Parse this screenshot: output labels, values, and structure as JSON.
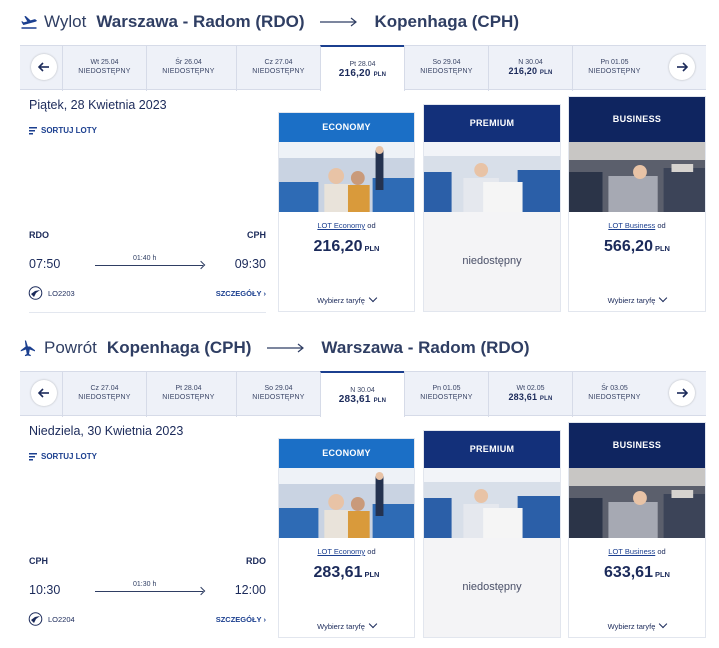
{
  "outbound": {
    "direction": "Wylot",
    "from": "Warszawa - Radom (RDO)",
    "to": "Kopenhaga (CPH)",
    "dates": [
      {
        "label": "Wt 25.04",
        "value": "NIEDOSTĘPNY",
        "price": false,
        "active": false
      },
      {
        "label": "Śr 26.04",
        "value": "NIEDOSTĘPNY",
        "price": false,
        "active": false
      },
      {
        "label": "Cz 27.04",
        "value": "NIEDOSTĘPNY",
        "price": false,
        "active": false
      },
      {
        "label": "Pt 28.04",
        "value": "216,20",
        "currency": "PLN",
        "price": true,
        "active": true
      },
      {
        "label": "So 29.04",
        "value": "NIEDOSTĘPNY",
        "price": false,
        "active": false
      },
      {
        "label": "N 30.04",
        "value": "216,20",
        "currency": "PLN",
        "price": true,
        "active": false
      },
      {
        "label": "Pn 01.05",
        "value": "NIEDOSTĘPNY",
        "price": false,
        "active": false
      }
    ],
    "date_line": "Piątek, 28 Kwietnia 2023",
    "sort_label": "SORTUJ LOTY",
    "from_code": "RDO",
    "to_code": "CPH",
    "dep_time": "07:50",
    "arr_time": "09:30",
    "duration": "01:40 h",
    "flight_no": "LO2203",
    "details": "SZCZEGÓŁY ›",
    "economy": {
      "title": "ECONOMY",
      "link": "LOT Economy",
      "from_word": "od",
      "price": "216,20",
      "currency": "PLN",
      "choose": "Wybierz taryfę"
    },
    "premium": {
      "title": "PREMIUM",
      "unavailable": "niedostępny"
    },
    "business": {
      "title": "BUSINESS",
      "link": "LOT Business",
      "from_word": "od",
      "price": "566,20",
      "currency": "PLN",
      "choose": "Wybierz taryfę"
    }
  },
  "return": {
    "direction": "Powrót",
    "from": "Kopenhaga (CPH)",
    "to": "Warszawa - Radom (RDO)",
    "dates": [
      {
        "label": "Cz 27.04",
        "value": "NIEDOSTĘPNY",
        "price": false,
        "active": false
      },
      {
        "label": "Pt 28.04",
        "value": "NIEDOSTĘPNY",
        "price": false,
        "active": false
      },
      {
        "label": "So 29.04",
        "value": "NIEDOSTĘPNY",
        "price": false,
        "active": false
      },
      {
        "label": "N 30.04",
        "value": "283,61",
        "currency": "PLN",
        "price": true,
        "active": true
      },
      {
        "label": "Pn 01.05",
        "value": "NIEDOSTĘPNY",
        "price": false,
        "active": false
      },
      {
        "label": "Wt 02.05",
        "value": "283,61",
        "currency": "PLN",
        "price": true,
        "active": false
      },
      {
        "label": "Śr 03.05",
        "value": "NIEDOSTĘPNY",
        "price": false,
        "active": false
      }
    ],
    "date_line": "Niedziela, 30 Kwietnia 2023",
    "sort_label": "SORTUJ LOTY",
    "from_code": "CPH",
    "to_code": "RDO",
    "dep_time": "10:30",
    "arr_time": "12:00",
    "duration": "01:30 h",
    "flight_no": "LO2204",
    "details": "SZCZEGÓŁY ›",
    "economy": {
      "title": "ECONOMY",
      "link": "LOT Economy",
      "from_word": "od",
      "price": "283,61",
      "currency": "PLN",
      "choose": "Wybierz taryfę"
    },
    "premium": {
      "title": "PREMIUM",
      "unavailable": "niedostępny"
    },
    "business": {
      "title": "BUSINESS",
      "link": "LOT Business",
      "from_word": "od",
      "price": "633,61",
      "currency": "PLN",
      "choose": "Wybierz taryfę"
    }
  },
  "colors": {
    "accent": "#1b3f8f",
    "economy": "#1b6fc6",
    "premium": "#13307a",
    "business": "#0f2560",
    "text": "#1b2a5a"
  }
}
